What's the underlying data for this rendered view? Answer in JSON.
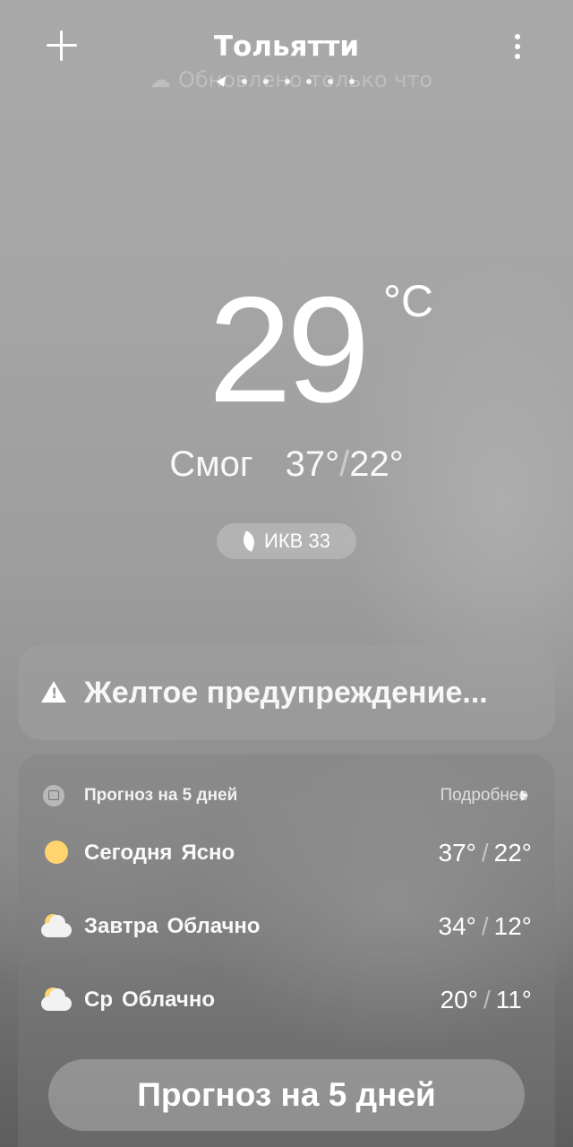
{
  "header": {
    "city": "Тольятти",
    "add_icon": "plus-icon",
    "menu_icon": "more-vertical-icon",
    "update_status": "Обновлено только что",
    "page_dots_count": 6
  },
  "current": {
    "temperature": "29",
    "unit": "°C",
    "condition": "Смог",
    "high": "37°",
    "low": "22°",
    "separator": "/",
    "aqi_label": "ИКВ 33",
    "aqi_icon": "leaf-icon"
  },
  "warning": {
    "icon": "warning-icon",
    "text": "Желтое предупреждение..."
  },
  "forecast": {
    "title": "Прогноз на 5 дней",
    "more_label": "Подробнее",
    "days": [
      {
        "day": "Сегодня",
        "condition": "Ясно",
        "high": "37°",
        "low": "22°",
        "icon": "sun-icon"
      },
      {
        "day": "Завтра",
        "condition": "Облачно",
        "high": "34°",
        "low": "12°",
        "icon": "partly-cloudy-icon"
      },
      {
        "day": "Ср",
        "condition": "Облачно",
        "high": "20°",
        "low": "11°",
        "icon": "partly-cloudy-icon"
      }
    ],
    "button_label": "Прогноз на 5 дней"
  },
  "colors": {
    "sun": "#ffd36e",
    "text": "#ffffff"
  }
}
